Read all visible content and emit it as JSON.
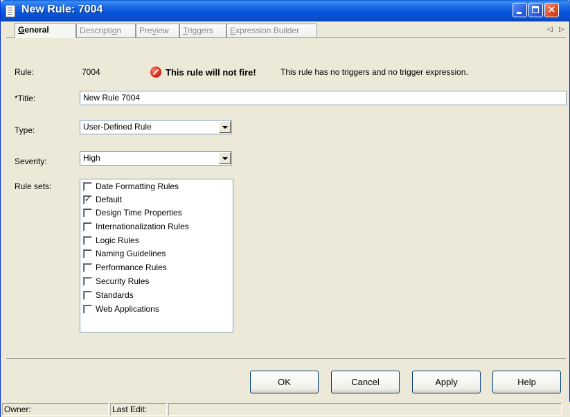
{
  "window": {
    "title": "New Rule: 7004"
  },
  "tabs": [
    {
      "pre": "",
      "u": "G",
      "post": "eneral"
    },
    {
      "pre": "Descripti",
      "u": "o",
      "post": "n"
    },
    {
      "pre": "Pre",
      "u": "v",
      "post": "iew"
    },
    {
      "pre": "",
      "u": "T",
      "post": "riggers"
    },
    {
      "pre": "",
      "u": "E",
      "post": "xpression Builder"
    }
  ],
  "general": {
    "rule_label": "Rule:",
    "rule_value": "7004",
    "warning_icon": "no-entry-icon",
    "warning_bold": "This rule will not fire!",
    "warning_text": "This rule has no triggers and no trigger expression.",
    "title_label": "*Title:",
    "title_value": "New Rule  7004",
    "type_label": "Type:",
    "type_value": "User-Defined Rule",
    "severity_label": "Severity:",
    "severity_value": "High",
    "rulesets_label": "Rule sets:",
    "rulesets": [
      {
        "label": "Date Formatting Rules",
        "checked": false
      },
      {
        "label": "Default",
        "checked": true
      },
      {
        "label": "Design Time Properties",
        "checked": false
      },
      {
        "label": "Internationalization Rules",
        "checked": false
      },
      {
        "label": "Logic Rules",
        "checked": false
      },
      {
        "label": "Naming Guidelines",
        "checked": false
      },
      {
        "label": "Performance Rules",
        "checked": false
      },
      {
        "label": "Security Rules",
        "checked": false
      },
      {
        "label": "Standards",
        "checked": false
      },
      {
        "label": "Web Applications",
        "checked": false
      }
    ]
  },
  "buttons": {
    "ok": "OK",
    "cancel": "Cancel",
    "apply": "Apply",
    "help": "Help"
  },
  "status": {
    "owner_label": "Owner:",
    "last_edit_label": "Last Edit:",
    "last_edit_value": ""
  }
}
